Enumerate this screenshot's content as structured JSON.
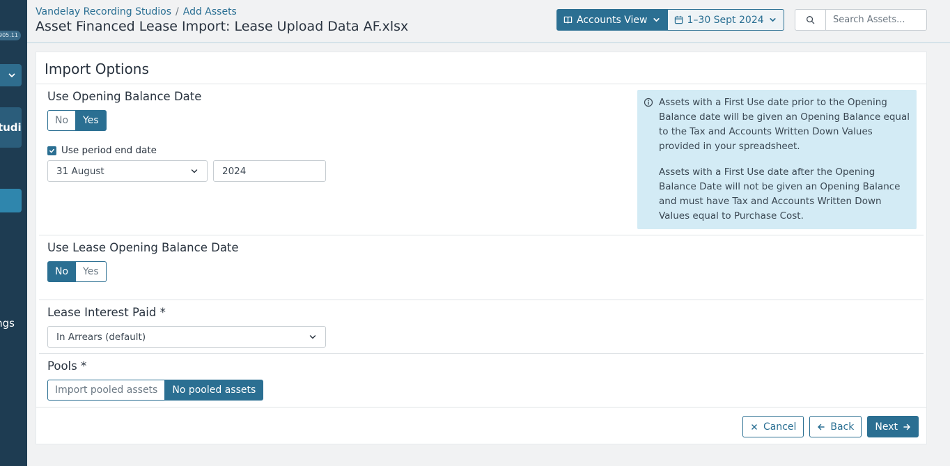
{
  "sidebar": {
    "version_badge": "905.11",
    "org_label": "Studio",
    "settings_label": "Settings"
  },
  "header": {
    "breadcrumb": [
      {
        "label": "Vandelay Recording Studios"
      },
      {
        "label": "Add Assets"
      }
    ],
    "title": "Asset Financed Lease Import: Lease Upload Data AF.xlsx",
    "view_label": "Accounts View",
    "date_range": "1–30 Sept 2024",
    "search_placeholder": "Search Assets..."
  },
  "card": {
    "title": "Import Options",
    "opening_balance": {
      "label": "Use Opening Balance Date",
      "options": [
        "No",
        "Yes"
      ],
      "selected": "Yes",
      "checkbox_label": "Use period end date",
      "checkbox_checked": true,
      "date_value": "31 August",
      "year_value": "2024"
    },
    "info": {
      "paragraph1": "Assets with a First Use date prior to the Opening Balance date will be given an Opening Balance equal to the Tax and Accounts Written Down Values provided in your spreadsheet.",
      "paragraph2": "Assets with a First Use date after the Opening Balance Date will not be given an Opening Balance and must have Tax and Accounts Written Down Values equal to Purchase Cost."
    },
    "lease_opening_balance": {
      "label": "Use Lease Opening Balance Date",
      "options": [
        "No",
        "Yes"
      ],
      "selected": "No"
    },
    "lease_interest": {
      "label": "Lease Interest Paid *",
      "value": "In Arrears (default)"
    },
    "pools": {
      "label": "Pools *",
      "options": [
        "Import pooled assets",
        "No pooled assets"
      ],
      "selected": "No pooled assets"
    },
    "buttons": {
      "cancel": "Cancel",
      "back": "Back",
      "next": "Next"
    }
  },
  "colors": {
    "primary": "#2b6f92",
    "sidebar": "#1e3c52",
    "info_bg": "#d3ebf5"
  }
}
